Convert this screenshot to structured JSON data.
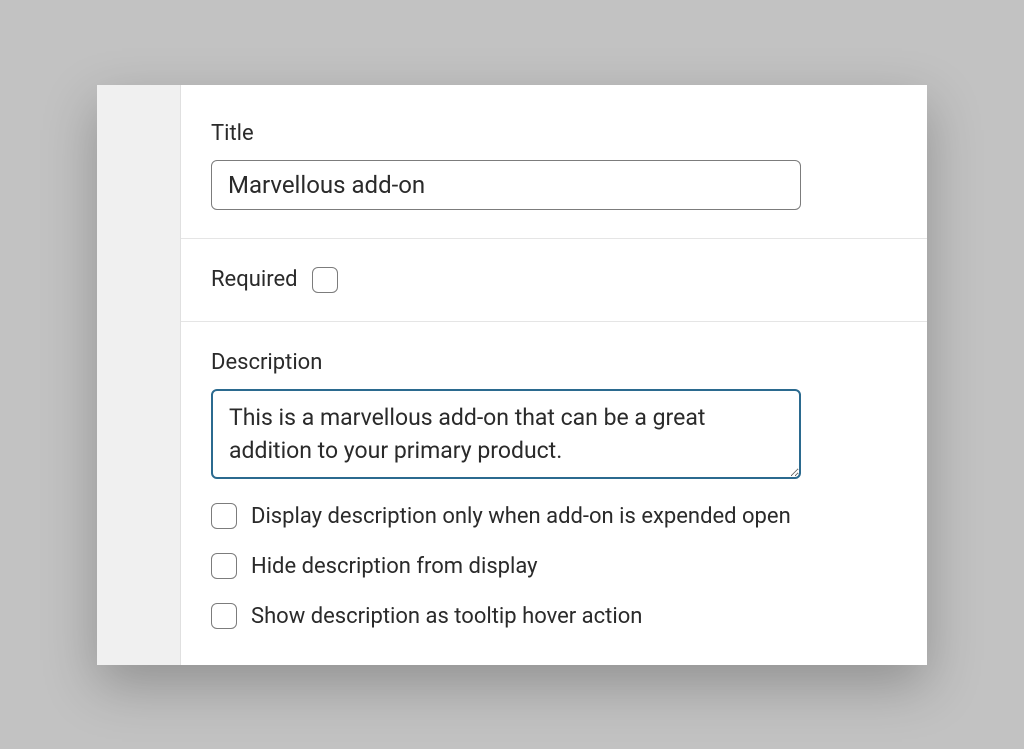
{
  "title": {
    "label": "Title",
    "value": "Marvellous add-on"
  },
  "required": {
    "label": "Required",
    "checked": false
  },
  "description": {
    "label": "Description",
    "value": "This is a marvellous add-on that can be a great addition to your primary product."
  },
  "options": [
    {
      "label": "Display description only when add-on is expended open",
      "checked": false
    },
    {
      "label": "Hide description from display",
      "checked": false
    },
    {
      "label": "Show description as tooltip hover action",
      "checked": false
    }
  ],
  "colors": {
    "focus_border": "#2b6a8f"
  }
}
